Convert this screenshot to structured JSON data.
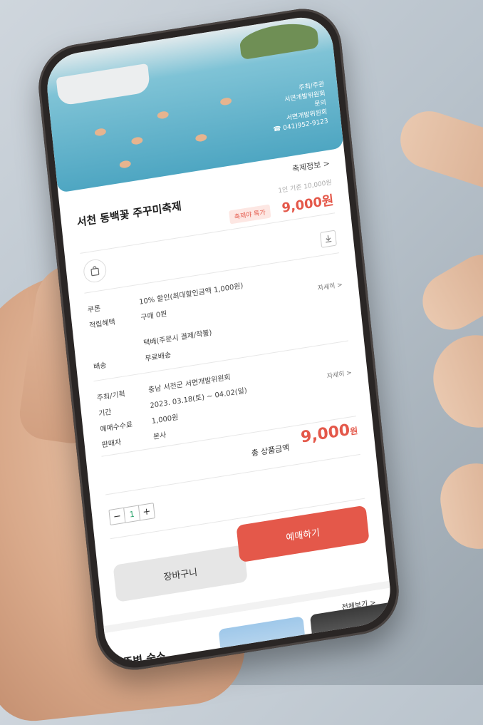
{
  "banner": {
    "host_label": "주최/주관",
    "host": "서면개발위원회",
    "inquiry_label": "문의",
    "inquiry_org": "서면개발위원회",
    "phone": "☎ 041)952-9123"
  },
  "festival_info_link": "축제정보 >",
  "product": {
    "title": "서천 동백꽃 주꾸미축제",
    "price_basis": "1인 기준 10,000원",
    "badge": "축제야 특가",
    "price": "9,000원"
  },
  "details": {
    "coupon_label": "쿠폰",
    "coupon_value": "10% 할인(최대할인금액 1,000원)",
    "points_label": "적립혜택",
    "points_value": "구매 0원",
    "points_link": "자세히 >",
    "delivery_label": "배송",
    "delivery_method": "택배(주문시 결제/착불)",
    "delivery_fee": "무료배송",
    "organizer_label": "주최/기획",
    "organizer_value": "충남 서천군 서면개발위원회",
    "period_label": "기간",
    "period_value": "2023. 03.18(토) ~ 04.02(일)",
    "period_link": "자세히 >",
    "fee_label": "예매수수료",
    "fee_value": "1,000원",
    "seller_label": "판매자",
    "seller_value": "본사"
  },
  "total": {
    "label": "총 상품금액",
    "amount": "9,000",
    "unit": "원"
  },
  "stepper": {
    "minus": "−",
    "qty": "1",
    "plus": "+"
  },
  "buttons": {
    "cart": "장바구니",
    "book": "예매하기"
  },
  "nearby": {
    "see_all": "전체보기 >",
    "title": "주변 숙소"
  },
  "colors": {
    "accent": "#e4584a",
    "banner": "#4ea6c2"
  }
}
